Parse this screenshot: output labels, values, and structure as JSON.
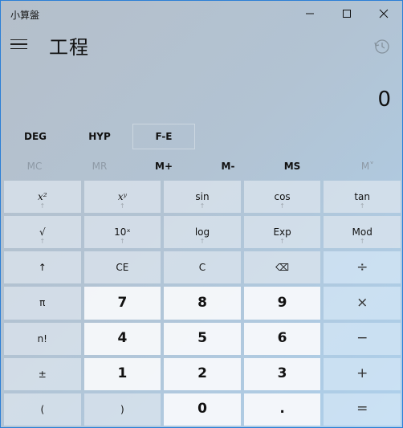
{
  "window": {
    "title": "小算盤",
    "controls": {
      "minimize": "—",
      "maximize": "☐",
      "close": "✕"
    }
  },
  "header": {
    "mode_title": "工程",
    "menu_icon": "hamburger-icon",
    "history_icon": "history-icon"
  },
  "display": {
    "value": "0"
  },
  "mode_buttons": [
    {
      "label": "DEG"
    },
    {
      "label": "HYP"
    },
    {
      "label": "F-E"
    }
  ],
  "memory_buttons": [
    {
      "label": "MC",
      "enabled": false
    },
    {
      "label": "MR",
      "enabled": false
    },
    {
      "label": "M+",
      "enabled": true
    },
    {
      "label": "M-",
      "enabled": true
    },
    {
      "label": "MS",
      "enabled": true
    },
    {
      "label": "M˅",
      "enabled": false
    }
  ],
  "keys": [
    {
      "label": "x²",
      "sub": "↑",
      "kind": "fn italic"
    },
    {
      "label": "xʸ",
      "sub": "↑",
      "kind": "fn italic"
    },
    {
      "label": "sin",
      "sub": "↑",
      "kind": "fn"
    },
    {
      "label": "cos",
      "sub": "↑",
      "kind": "fn"
    },
    {
      "label": "tan",
      "sub": "↑",
      "kind": "fn"
    },
    {
      "label": "√",
      "sub": "↑",
      "kind": "fn"
    },
    {
      "label": "10ˣ",
      "sub": "↑",
      "kind": "fn"
    },
    {
      "label": "log",
      "sub": "↑",
      "kind": "fn"
    },
    {
      "label": "Exp",
      "sub": "↑",
      "kind": "fn"
    },
    {
      "label": "Mod",
      "sub": "↑",
      "kind": "fn"
    },
    {
      "label": "↑",
      "sub": "",
      "kind": "fn"
    },
    {
      "label": "CE",
      "sub": "",
      "kind": "fn"
    },
    {
      "label": "C",
      "sub": "",
      "kind": "fn"
    },
    {
      "label": "⌫",
      "sub": "",
      "kind": "fn"
    },
    {
      "label": "÷",
      "sub": "",
      "kind": "op"
    },
    {
      "label": "π",
      "sub": "",
      "kind": "fn"
    },
    {
      "label": "7",
      "sub": "",
      "kind": "num"
    },
    {
      "label": "8",
      "sub": "",
      "kind": "num"
    },
    {
      "label": "9",
      "sub": "",
      "kind": "num"
    },
    {
      "label": "×",
      "sub": "",
      "kind": "op"
    },
    {
      "label": "n!",
      "sub": "",
      "kind": "fn"
    },
    {
      "label": "4",
      "sub": "",
      "kind": "num"
    },
    {
      "label": "5",
      "sub": "",
      "kind": "num"
    },
    {
      "label": "6",
      "sub": "",
      "kind": "num"
    },
    {
      "label": "−",
      "sub": "",
      "kind": "op"
    },
    {
      "label": "±",
      "sub": "",
      "kind": "fn"
    },
    {
      "label": "1",
      "sub": "",
      "kind": "num"
    },
    {
      "label": "2",
      "sub": "",
      "kind": "num"
    },
    {
      "label": "3",
      "sub": "",
      "kind": "num"
    },
    {
      "label": "+",
      "sub": "",
      "kind": "op"
    },
    {
      "label": "(",
      "sub": "",
      "kind": "fn"
    },
    {
      "label": ")",
      "sub": "",
      "kind": "fn"
    },
    {
      "label": "0",
      "sub": "",
      "kind": "num"
    },
    {
      "label": ".",
      "sub": "",
      "kind": "num"
    },
    {
      "label": "=",
      "sub": "",
      "kind": "op"
    }
  ]
}
